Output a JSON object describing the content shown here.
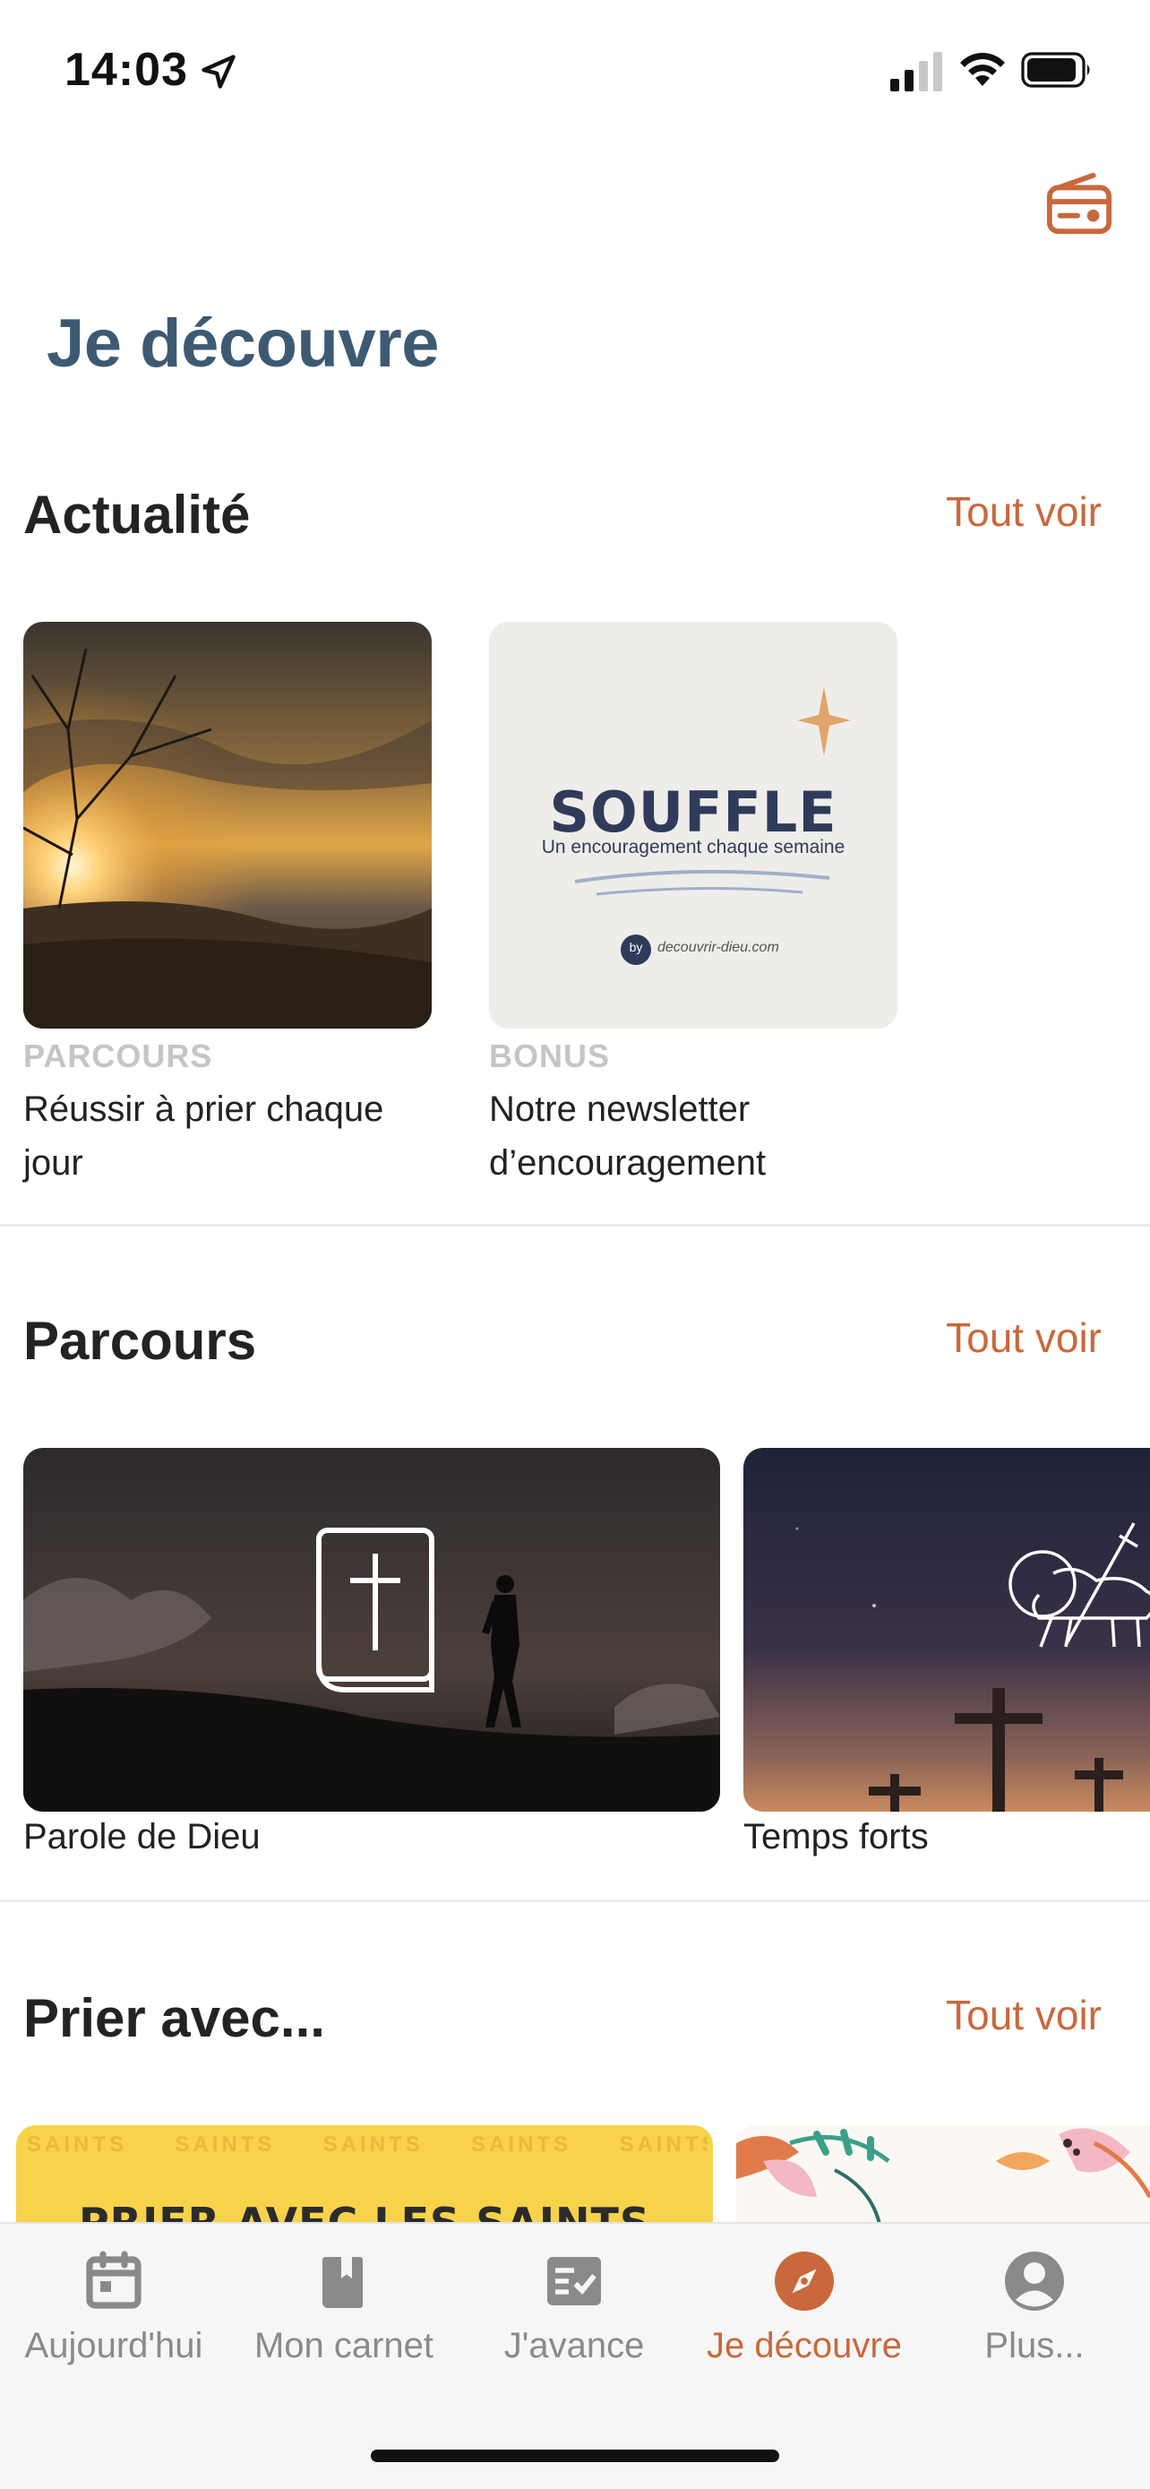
{
  "status_bar": {
    "time": "14:03"
  },
  "header": {
    "title": "Je découvre",
    "radio_icon": "radio-icon"
  },
  "sections": {
    "news": {
      "title": "Actualité",
      "see_all": "Tout voir",
      "items": [
        {
          "kicker": "PARCOURS",
          "title": "Réussir à prier chaque jour"
        },
        {
          "kicker": "BONUS",
          "title": "Notre newsletter d’encouragement",
          "art": {
            "headline": "SOUFFLE",
            "tagline": "Un encouragement chaque semaine",
            "by": "by",
            "site": "decouvrir-dieu.com"
          }
        }
      ]
    },
    "journeys": {
      "title": "Parcours",
      "see_all": "Tout voir",
      "items": [
        {
          "title": "Parole de Dieu"
        },
        {
          "title": "Temps forts"
        }
      ]
    },
    "pray_with": {
      "title": "Prier avec...",
      "see_all": "Tout voir",
      "items": [
        {
          "art_text": "PRIER AVEC LES SAINTS",
          "pattern_text": "SAINTS"
        },
        {
          "art_text": ""
        }
      ]
    }
  },
  "tab_bar": {
    "items": [
      {
        "label": "Aujourd'hui",
        "icon": "calendar-icon"
      },
      {
        "label": "Mon carnet",
        "icon": "book-icon"
      },
      {
        "label": "J'avance",
        "icon": "checklist-icon"
      },
      {
        "label": "Je découvre",
        "icon": "compass-icon",
        "active": true
      },
      {
        "label": "Plus...",
        "icon": "profile-icon"
      }
    ]
  },
  "colors": {
    "accent": "#c9683c",
    "title": "#3d5a73",
    "inactive": "#8a8a8a"
  }
}
